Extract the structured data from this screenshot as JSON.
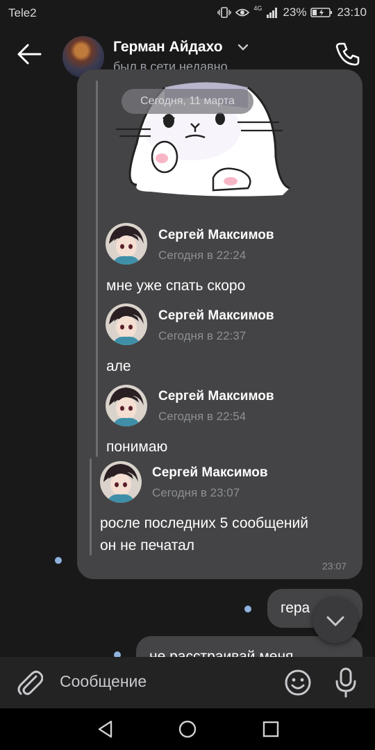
{
  "status_bar": {
    "carrier": "Tele2",
    "network": "4G",
    "battery": "23%",
    "time": "23:10"
  },
  "header": {
    "name": "Герман Айдахо",
    "status": "был в сети недавно"
  },
  "date_label": "Сегодня, 11 марта",
  "forwarded": [
    {
      "author": "Сергей Максимов",
      "time": "Сегодня в 22:24",
      "text": "мне уже спать скоро"
    },
    {
      "author": "Сергей Максимов",
      "time": "Сегодня в 22:37",
      "text": "але"
    },
    {
      "author": "Сергей Максимов",
      "time": "Сегодня в 22:54",
      "text": "понимаю"
    },
    {
      "author": "Сергей Максимов",
      "time": "Сегодня в 23:07",
      "text_line1": "росле последних 5 сообщений",
      "text_line2": "он не печатал"
    }
  ],
  "bubble_time": "23:07",
  "outgoing": [
    {
      "text": "гера"
    },
    {
      "text": "не расстраивай меня"
    }
  ],
  "composer": {
    "placeholder": "Сообщение"
  },
  "colors": {
    "background": "#19191a",
    "bubble": "#444446",
    "unread_dot": "#8fb1dd"
  },
  "icons": [
    "back-arrow-icon",
    "chevron-down-icon",
    "phone-icon",
    "attach-icon",
    "emoji-icon",
    "mic-icon",
    "scroll-down-icon",
    "nav-back-icon",
    "nav-home-icon",
    "nav-recents-icon"
  ]
}
